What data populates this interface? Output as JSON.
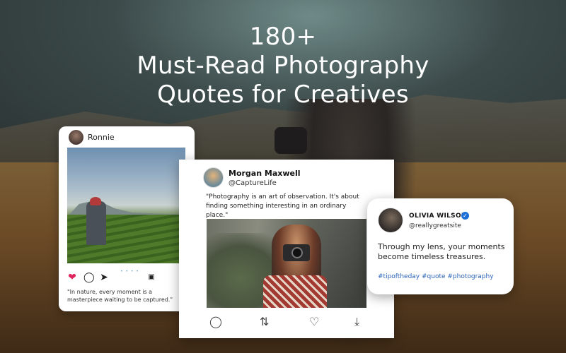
{
  "headline": {
    "line1": "180+",
    "line2": "Must-Read Photography",
    "line3": "Quotes for Creatives"
  },
  "instagram_card": {
    "username": "Ronnie",
    "caption": "\"In nature, every moment is a masterpiece waiting to be captured.\"",
    "carousel_dots": "• • • •",
    "icons": [
      "heart-icon",
      "comment-icon",
      "send-icon",
      "gallery-icon",
      "bookmark-icon"
    ]
  },
  "tweet_card": {
    "name": "Morgan Maxwell",
    "handle": "@CaptureLife",
    "text": "\"Photography is an art of observation. It's about finding something interesting in an ordinary place.\"",
    "icons": [
      "comment-icon",
      "retweet-icon",
      "like-icon",
      "download-icon"
    ]
  },
  "olivia_card": {
    "name": "OLIVIA WILSON",
    "handle": "@reallygreatsite",
    "text": "Through my lens, your moments become timeless treasures.",
    "hashtags": "#tipoftheday #quote #photography",
    "verified": true
  },
  "colors": {
    "heart": "#e0245e",
    "hashtag": "#2b63b8",
    "verified": "#1d6fd8"
  }
}
